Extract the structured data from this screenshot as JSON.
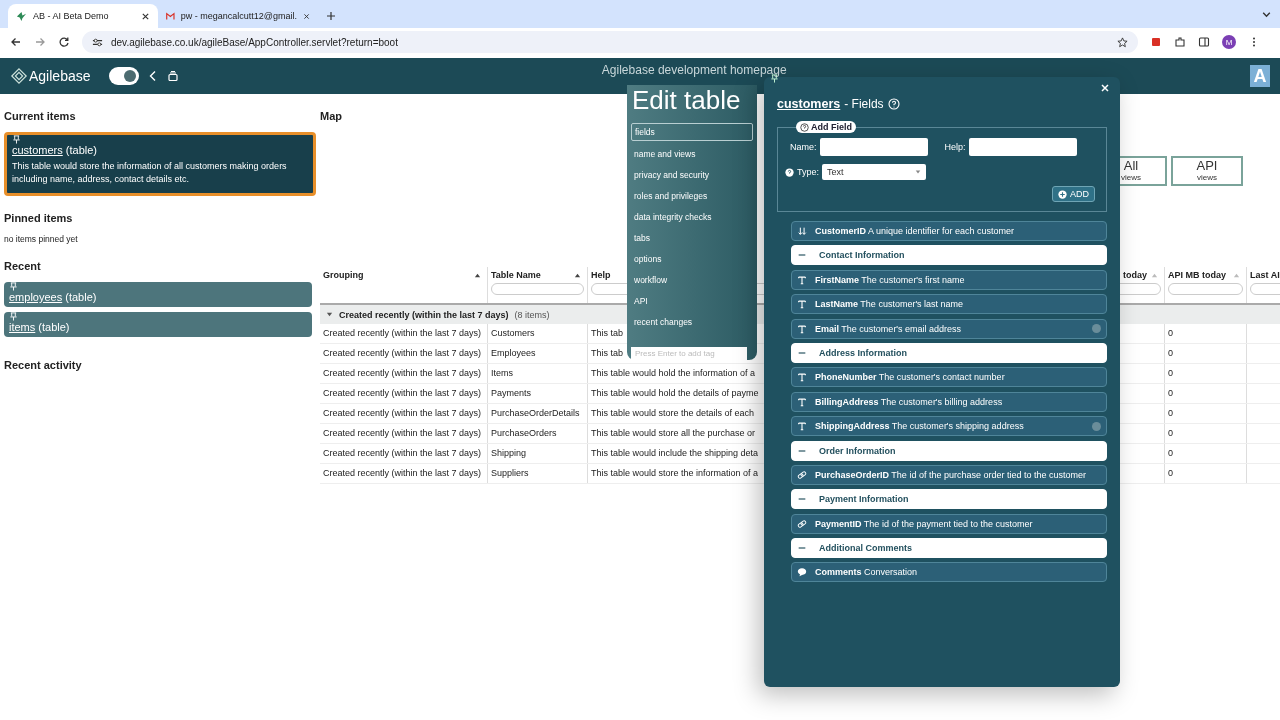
{
  "browser": {
    "tabs": [
      {
        "title": "AB - AI Beta Demo",
        "selected": true
      },
      {
        "title": "pw - megancalcutt12@gmail.",
        "selected": false
      }
    ],
    "url": "dev.agilebase.co.uk/agileBase/AppController.servlet?return=boot",
    "profile": "M"
  },
  "header": {
    "brand": "Agilebase",
    "toggle_on": true,
    "title": "Agilebase development homepage",
    "corner_logo": "A"
  },
  "sidebar": {
    "current_heading": "Current items",
    "current": [
      {
        "name": "customers",
        "suffix": "(table)",
        "description": "This table would store the information of all customers making orders including name, address, contact details etc."
      }
    ],
    "pinned_heading": "Pinned items",
    "pinned_empty": "no items pinned yet",
    "recent_heading": "Recent",
    "recent": [
      {
        "name": "employees",
        "suffix": "(table)"
      },
      {
        "name": "items",
        "suffix": "(table)"
      }
    ],
    "activity_heading": "Recent activity"
  },
  "map": {
    "heading": "Map",
    "buttons": [
      {
        "big": "All",
        "small": "views"
      },
      {
        "big": "API",
        "small": "views"
      }
    ]
  },
  "table": {
    "columns": [
      {
        "label": "Grouping",
        "filter": false
      },
      {
        "label": "Table Name",
        "filter": true
      },
      {
        "label": "Help",
        "filter": true
      },
      {
        "label": "today",
        "filter": true
      },
      {
        "label": "API MB today",
        "filter": true
      },
      {
        "label": "Last AI",
        "filter": true
      }
    ],
    "group": {
      "label": "Created recently (within the last 7 days)",
      "count": "(8 items)",
      "expanded": true
    },
    "rows": [
      {
        "grouping": "Created recently (within the last 7 days)",
        "name": "Customers",
        "help": "This tab",
        "api_mb": "0"
      },
      {
        "grouping": "Created recently (within the last 7 days)",
        "name": "Employees",
        "help": "This tab",
        "api_mb": "0"
      },
      {
        "grouping": "Created recently (within the last 7 days)",
        "name": "Items",
        "help": "This table would hold the information of a",
        "api_mb": "0"
      },
      {
        "grouping": "Created recently (within the last 7 days)",
        "name": "Payments",
        "help": "This table would hold the details of payme",
        "api_mb": "0"
      },
      {
        "grouping": "Created recently (within the last 7 days)",
        "name": "PurchaseOrderDetails",
        "help": "This table would store the details of each",
        "api_mb": "0"
      },
      {
        "grouping": "Created recently (within the last 7 days)",
        "name": "PurchaseOrders",
        "help": "This table would store all the purchase or",
        "api_mb": "0"
      },
      {
        "grouping": "Created recently (within the last 7 days)",
        "name": "Shipping",
        "help": "This table would include the shipping deta",
        "api_mb": "0"
      },
      {
        "grouping": "Created recently (within the last 7 days)",
        "name": "Suppliers",
        "help": "This table would store the information of a",
        "api_mb": "0"
      }
    ]
  },
  "edit_table": {
    "title": "Edit table",
    "menu": [
      {
        "label": "fields",
        "selected": true
      },
      {
        "label": "name and views",
        "selected": false
      },
      {
        "label": "privacy and security",
        "selected": false
      },
      {
        "label": "roles and privileges",
        "selected": false
      },
      {
        "label": "data integrity checks",
        "selected": false
      },
      {
        "label": "tabs",
        "selected": false
      },
      {
        "label": "options",
        "selected": false
      },
      {
        "label": "workflow",
        "selected": false
      },
      {
        "label": "API",
        "selected": false
      },
      {
        "label": "recent changes",
        "selected": false
      }
    ],
    "tag_placeholder": "Press Enter to add tag"
  },
  "fields_dialog": {
    "table_name": "customers",
    "title": "- Fields",
    "add_field": {
      "legend": "Add Field",
      "name_label": "Name:",
      "help_label": "Help:",
      "type_label": "Type:",
      "type_value": "Text",
      "add_button": "ADD"
    },
    "fields": [
      {
        "kind": "id",
        "name": "CustomerID",
        "description": "A unique identifier for each customer",
        "badge": false
      },
      {
        "kind": "heading",
        "name": "Contact Information"
      },
      {
        "kind": "text",
        "name": "FirstName",
        "description": "The customer's first name",
        "badge": false
      },
      {
        "kind": "text",
        "name": "LastName",
        "description": "The customer's last name",
        "badge": false
      },
      {
        "kind": "text",
        "name": "Email",
        "description": "The customer's email address",
        "badge": true
      },
      {
        "kind": "heading",
        "name": "Address Information"
      },
      {
        "kind": "text",
        "name": "PhoneNumber",
        "description": "The customer's contact number",
        "badge": false
      },
      {
        "kind": "text",
        "name": "BillingAddress",
        "description": "The customer's billing address",
        "badge": false
      },
      {
        "kind": "text",
        "name": "ShippingAddress",
        "description": "The customer's shipping address",
        "badge": true
      },
      {
        "kind": "heading",
        "name": "Order Information"
      },
      {
        "kind": "relation",
        "name": "PurchaseOrderID",
        "description": "The id of the purchase order tied to the customer",
        "badge": false
      },
      {
        "kind": "heading",
        "name": "Payment Information"
      },
      {
        "kind": "relation",
        "name": "PaymentID",
        "description": "The id of the payment tied to the customer",
        "badge": false
      },
      {
        "kind": "heading",
        "name": "Additional Comments"
      },
      {
        "kind": "comment",
        "name": "Comments",
        "description": "Conversation",
        "badge": false
      }
    ]
  }
}
